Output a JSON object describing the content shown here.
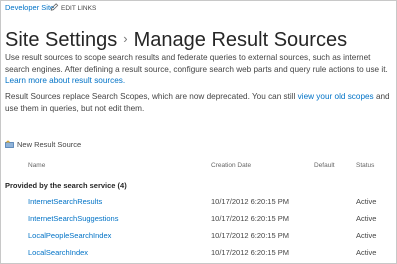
{
  "topbar": {
    "site_link": "Developer Site",
    "edit_links": "EDIT LINKS"
  },
  "title": {
    "parent": "Site Settings",
    "separator": "›",
    "current": "Manage Result Sources"
  },
  "intro": {
    "text": "Use result sources to scope search results and federate queries to external sources, such as internet search engines. After defining a result source, configure search web parts and query rule actions to use it.",
    "link": "Learn more about result sources."
  },
  "deprecation": {
    "before": "Result Sources replace Search Scopes, which are now deprecated. You can still",
    "link": "view your old scopes",
    "after": "and use them in queries, but not edit them."
  },
  "toolbar": {
    "new_label": "New Result Source"
  },
  "table": {
    "headers": {
      "name": "Name",
      "date": "Creation Date",
      "default": "Default",
      "status": "Status"
    },
    "group_label": "Provided by the search service (4)",
    "rows": [
      {
        "name": "InternetSearchResults",
        "date": "10/17/2012 6:20:15 PM",
        "status": "Active"
      },
      {
        "name": "InternetSearchSuggestions",
        "date": "10/17/2012 6:20:15 PM",
        "status": "Active"
      },
      {
        "name": "LocalPeopleSearchIndex",
        "date": "10/17/2012 6:20:15 PM",
        "status": "Active"
      },
      {
        "name": "LocalSearchIndex",
        "date": "10/17/2012 6:20:15 PM",
        "status": "Active"
      }
    ]
  },
  "colors": {
    "link": "#0072c6",
    "text": "#444444",
    "title": "#262626"
  },
  "icons": {
    "edit": "pencil-icon",
    "new": "new-item-icon"
  }
}
